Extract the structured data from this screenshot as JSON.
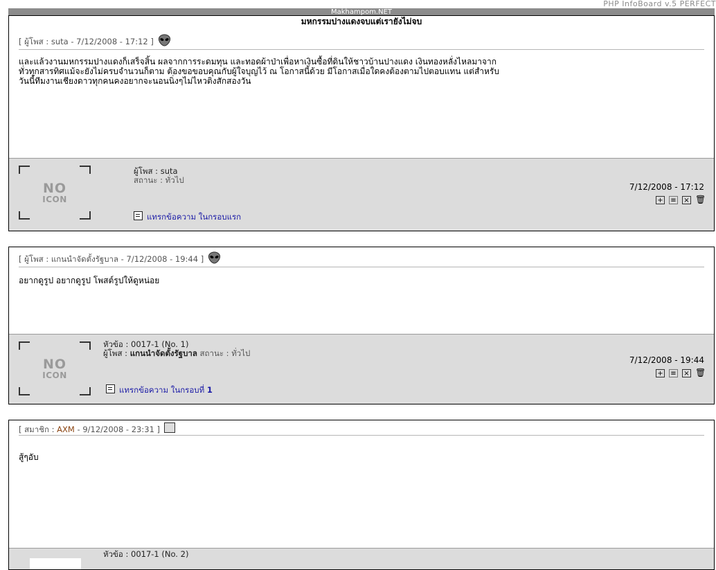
{
  "board": {
    "version": "PHP InfoBoard v.5 PERFECT",
    "site": "Makhampom.NET",
    "topic_title": "มหกรรมปางแดงจบแต่เรายังไม่จบ"
  },
  "posts": [
    {
      "header_label": "ผู้โพส",
      "author": "suta",
      "datetime": "7/12/2008 - 17:12",
      "header_icon": "alien-icon",
      "body_lines": [
        "และแล้วงานมหกรรมปางแดงก็เสร็จสิ้น ผลจากการระดมทุน และทอดผ้าป่าเพื่อหาเงินซื้อที่ดินให้ชาวบ้านปางแดง เงินทองหลั่งไหลมาจาก",
        "ทั่วทุกสารทิศแม้จะยังไม่ครบจำนวนก็ตาม ต้องขอขอบคุณกับผู้ใจบุญไว้ ณ โอกาสนี้ด้วย มีโอกาสเมื่อใดคงต้องตามไปตอบแทน แต่สำหรับ",
        "วันนี้ทีมงานเชียงดาวทุกคนคงอยากจะนอนนิ่งๆไม่ไหวติงสักสองวัน"
      ],
      "footer": {
        "avatar_line1": "NO",
        "avatar_line2": "ICON",
        "poster_label": "ผู้โพส : ",
        "poster": "suta",
        "status_label": "สถานะ : ",
        "status": "ทั่วไป",
        "insert_text": "แทรกข้อความ ในกรอบแรก",
        "datetime": "7/12/2008 - 17:12"
      }
    },
    {
      "header_label": "ผู้โพส",
      "author": "แกนนำจัดตั้งรัฐบาล",
      "datetime": "7/12/2008 - 19:44",
      "header_icon": "alien-icon",
      "body_lines": [
        "อยากดูรูป อยากดูรูป โพสต์รูปให้ดูหน่อย"
      ],
      "footer": {
        "avatar_line1": "NO",
        "avatar_line2": "ICON",
        "topic_label": "หัวข้อ : ",
        "topic": "0017-1 (No. 1)",
        "poster_label": "ผู้โพส : ",
        "poster": "แกนนำจัดตั้งรัฐบาล",
        "status_label": " สถานะ : ",
        "status": "ทั่วไป",
        "insert_text": "แทรกข้อความ ในกรอบที่ ",
        "insert_num": "1",
        "datetime": "7/12/2008 - 19:44"
      }
    },
    {
      "header_label": "สมาชิก",
      "author": "AXM",
      "datetime": "9/12/2008 - 23:31",
      "header_icon": "member-card-icon",
      "body_lines": [
        "สู้ๆอับ"
      ],
      "footer": {
        "topic_label": "หัวข้อ : ",
        "topic": "0017-1 (No. 2)"
      }
    }
  ],
  "tool_icons": [
    "add-icon",
    "quote-icon",
    "edit-icon",
    "delete-icon"
  ]
}
